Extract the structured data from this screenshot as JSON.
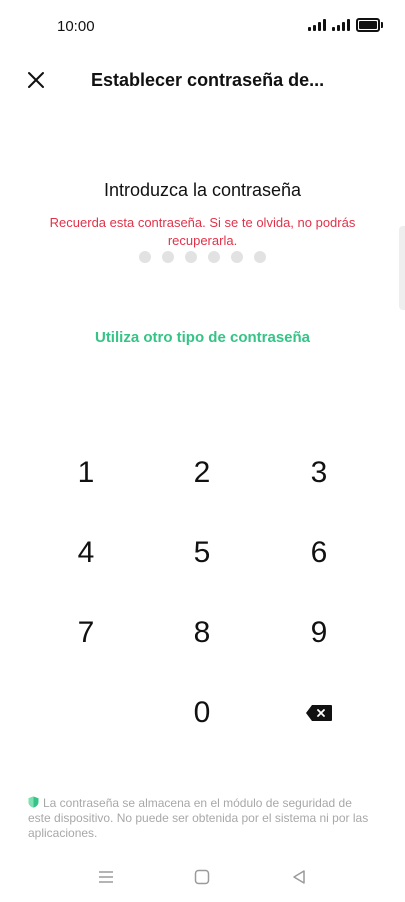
{
  "status_bar": {
    "time": "10:00"
  },
  "header": {
    "title": "Establecer contraseña de..."
  },
  "main": {
    "prompt": "Introduzca la contraseña",
    "warning": "Recuerda esta contraseña. Si se te olvida, no podrás recuperarla.",
    "dot_count": 6,
    "alt_link": "Utiliza otro tipo de contraseña"
  },
  "keypad": {
    "k1": "1",
    "k2": "2",
    "k3": "3",
    "k4": "4",
    "k5": "5",
    "k6": "6",
    "k7": "7",
    "k8": "8",
    "k9": "9",
    "k0": "0"
  },
  "footer": {
    "note": "La contraseña se almacena en el módulo de seguridad de este dispositivo. No puede ser obtenida por el sistema ni por las aplicaciones."
  },
  "colors": {
    "warning": "#e0334a",
    "accent": "#35c486",
    "dot_inactive": "#e2e2e2",
    "footer_text": "#a8a8a8"
  },
  "icons": {
    "close": "close-icon",
    "backspace": "backspace-icon",
    "shield": "shield-icon",
    "nav_menu": "menu-icon",
    "nav_home": "home-icon",
    "nav_back": "back-icon"
  }
}
